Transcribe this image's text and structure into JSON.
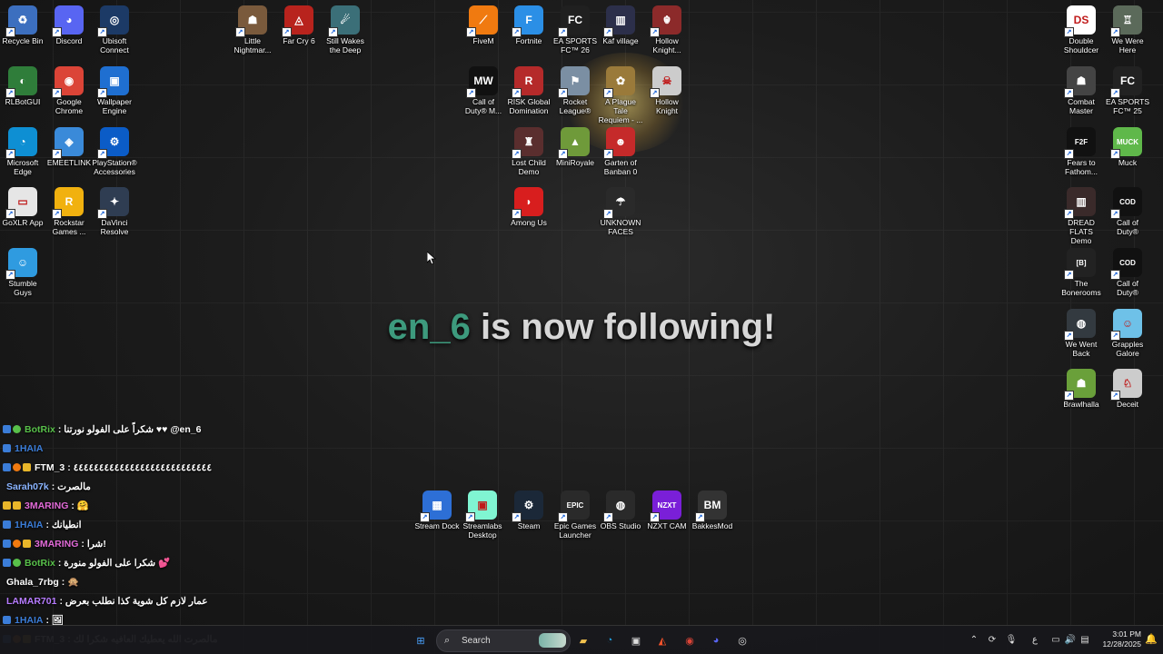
{
  "desktop": {
    "left_icons": [
      {
        "label": "Recycle Bin",
        "icon": "recycle-bin-icon",
        "color": "#3c6fbf",
        "glyph": "♻"
      },
      {
        "label": "Discord",
        "icon": "discord-icon",
        "color": "#5865f2",
        "glyph": "◕"
      },
      {
        "label": "Ubisoft Connect",
        "icon": "ubisoft-icon",
        "color": "#1c3a66",
        "glyph": "◎"
      },
      {
        "label": "RLBotGUI",
        "icon": "rlbot-icon",
        "color": "#2f7d3a",
        "glyph": "◐"
      },
      {
        "label": "Google Chrome",
        "icon": "chrome-icon",
        "color": "#db4437",
        "glyph": "◉"
      },
      {
        "label": "Wallpaper Engine",
        "icon": "wallpaper-engine-icon",
        "color": "#1f6fd1",
        "glyph": "▣"
      },
      {
        "label": "Microsoft Edge",
        "icon": "edge-icon",
        "color": "#0e8fd3",
        "glyph": "◔"
      },
      {
        "label": "EMEETLINK",
        "icon": "emeetlink-icon",
        "color": "#3a8ad9",
        "glyph": "◈"
      },
      {
        "label": "PlayStation® Accessories",
        "icon": "playstation-icon",
        "color": "#0b5cc7",
        "glyph": "⚙"
      },
      {
        "label": "GoXLR App",
        "icon": "goxlr-icon",
        "color": "#e6e6e6",
        "glyph": "▭"
      },
      {
        "label": "Rockstar Games ...",
        "icon": "rockstar-icon",
        "color": "#f1b10f",
        "glyph": "R"
      },
      {
        "label": "DaVinci Resolve",
        "icon": "davinci-icon",
        "color": "#2f3d52",
        "glyph": "✦"
      },
      {
        "label": "Stumble Guys",
        "icon": "stumble-guys-icon",
        "color": "#2f9be0",
        "glyph": "☺"
      }
    ],
    "top_games": [
      {
        "label": "Little Nightmar...",
        "icon": "little-nightmares-icon",
        "color": "#7a5a3c",
        "glyph": "☗"
      },
      {
        "label": "Far Cry 6",
        "icon": "far-cry-6-icon",
        "color": "#b8231d",
        "glyph": "◬"
      },
      {
        "label": "Still Wakes the Deep",
        "icon": "still-wakes-icon",
        "color": "#3b6f78",
        "glyph": "☄"
      }
    ],
    "mid_icons": [
      {
        "label": "FiveM",
        "icon": "fivem-icon",
        "color": "#f07a10",
        "glyph": "⟋"
      },
      {
        "label": "Fortnite",
        "icon": "fortnite-icon",
        "color": "#2b8fe6",
        "glyph": "F"
      },
      {
        "label": "EA SPORTS FC™ 26",
        "icon": "ea-fc26-icon",
        "color": "#202020",
        "glyph": "FC"
      },
      {
        "label": "Kaf village",
        "icon": "kaf-village-icon",
        "color": "#2c2f4a",
        "glyph": "▥"
      },
      {
        "label": "Hollow Knight...",
        "icon": "hollow-knight-silksong-icon",
        "color": "#8c2a2a",
        "glyph": "☬"
      },
      {
        "label": "Call of Duty® M...",
        "icon": "cod-mw3-icon",
        "color": "#111111",
        "glyph": "MW"
      },
      {
        "label": "RISK Global Domination",
        "icon": "risk-icon",
        "color": "#b52a2a",
        "glyph": "R"
      },
      {
        "label": "Rocket League®",
        "icon": "rocket-league-icon",
        "color": "#7b8fa3",
        "glyph": "⚑"
      },
      {
        "label": "A Plague Tale Requiem - ...",
        "icon": "plague-tale-icon",
        "color": "#9a7a3a",
        "glyph": "✿"
      },
      {
        "label": "Hollow Knight",
        "icon": "hollow-knight-icon",
        "color": "#cccccc",
        "glyph": "☠"
      },
      {
        "label": "Lost Child Demo",
        "icon": "lost-child-icon",
        "color": "#5a2e2e",
        "glyph": "♜"
      },
      {
        "label": "MiniRoyale",
        "icon": "miniroyale-icon",
        "color": "#6f9a3a",
        "glyph": "▲"
      },
      {
        "label": "Garten of Banban 0",
        "icon": "banban-icon",
        "color": "#c52a2a",
        "glyph": "☻"
      },
      {
        "label": "Among Us",
        "icon": "among-us-icon",
        "color": "#d81e1e",
        "glyph": "◗"
      },
      {
        "label": "UNKNOWN FACES",
        "icon": "unknown-faces-icon",
        "color": "#2a2a2a",
        "glyph": "☂"
      }
    ],
    "dock_icons": [
      {
        "label": "Stream Dock",
        "icon": "stream-dock-icon",
        "color": "#2d6fd6",
        "glyph": "▦"
      },
      {
        "label": "Streamlabs Desktop",
        "icon": "streamlabs-icon",
        "color": "#80f5d2",
        "glyph": "▣"
      },
      {
        "label": "Steam",
        "icon": "steam-icon",
        "color": "#1b2838",
        "glyph": "⚙"
      },
      {
        "label": "Epic Games Launcher",
        "icon": "epic-games-icon",
        "color": "#2a2a2a",
        "glyph": "EPIC"
      },
      {
        "label": "OBS Studio",
        "icon": "obs-icon",
        "color": "#2a2a2a",
        "glyph": "◍"
      },
      {
        "label": "NZXT CAM",
        "icon": "nzxt-cam-icon",
        "color": "#7a1fd8",
        "glyph": "NZXT"
      },
      {
        "label": "BakkesMod",
        "icon": "bakkesmod-icon",
        "color": "#333333",
        "glyph": "BM"
      }
    ],
    "right_icons": [
      {
        "label": "Double Shouldcer",
        "icon": "double-shouldcer-icon",
        "color": "#ffffff",
        "glyph": "DS"
      },
      {
        "label": "We Were Here",
        "icon": "we-were-here-icon",
        "color": "#5b6a5a",
        "glyph": "♖"
      },
      {
        "label": "Combat Master",
        "icon": "combat-master-icon",
        "color": "#444444",
        "glyph": "☗"
      },
      {
        "label": "EA SPORTS FC™ 25",
        "icon": "ea-fc25-icon",
        "color": "#222222",
        "glyph": "FC"
      },
      {
        "label": "Fears to Fathom...",
        "icon": "fears-to-fathom-icon",
        "color": "#111111",
        "glyph": "F2F"
      },
      {
        "label": "Muck",
        "icon": "muck-icon",
        "color": "#5fb84a",
        "glyph": "MUCK"
      },
      {
        "label": "DREAD FLATS Demo",
        "icon": "dread-flats-icon",
        "color": "#3a2a2a",
        "glyph": "▥"
      },
      {
        "label": "Call of Duty®",
        "icon": "cod-icon-1",
        "color": "#111111",
        "glyph": "COD"
      },
      {
        "label": "The Bonerooms",
        "icon": "bonerooms-icon",
        "color": "#222222",
        "glyph": "[B]"
      },
      {
        "label": "Call of Duty®",
        "icon": "cod-icon-2",
        "color": "#111111",
        "glyph": "COD"
      },
      {
        "label": "We Went Back",
        "icon": "we-went-back-icon",
        "color": "#333a40",
        "glyph": "◍"
      },
      {
        "label": "Grapples Galore",
        "icon": "grapples-galore-icon",
        "color": "#6ec1e8",
        "glyph": "☺"
      },
      {
        "label": "Brawlhalla",
        "icon": "brawlhalla-icon",
        "color": "#6aa03a",
        "glyph": "☗"
      },
      {
        "label": "Deceit",
        "icon": "deceit-icon",
        "color": "#cccccc",
        "glyph": "♘"
      }
    ]
  },
  "alert": {
    "username": "en_6",
    "message": "is now following!"
  },
  "chat": [
    {
      "user": "BotRix",
      "color": "#58c04a",
      "badges": [
        "b-blue",
        "b-green"
      ],
      "text": ": شكراً على الفولو نورتنا ♥♥ @en_6"
    },
    {
      "user": "1HAIA",
      "color": "#3b7dd8",
      "badges": [
        "b-blue"
      ],
      "text": ""
    },
    {
      "user": "FTM_3",
      "color": "#ffffff",
      "badges": [
        "b-blue",
        "b-orange",
        "b-gold"
      ],
      "text": ": ٤٤٤٤٤٤٤٤٤٤٤٤٤٤٤٤٤٤٤٤٤٤٤٤٤٤٤"
    },
    {
      "user": "Sarah07k",
      "color": "#8ab4ff",
      "badges": [],
      "text": ": مالصرت"
    },
    {
      "user": "3MARING",
      "color": "#e26ad8",
      "badges": [
        "b-gold",
        "b-gold"
      ],
      "text": ": 🤗"
    },
    {
      "user": "1HAIA",
      "color": "#3b7dd8",
      "badges": [
        "b-blue"
      ],
      "text": ": انطيانك"
    },
    {
      "user": "3MARING",
      "color": "#e26ad8",
      "badges": [
        "b-blue",
        "b-orange",
        "b-gold"
      ],
      "text": ": شرا!"
    },
    {
      "user": "BotRix",
      "color": "#58c04a",
      "badges": [
        "b-blue",
        "b-green"
      ],
      "text": ": شكرا على الفولو منورة 💕"
    },
    {
      "user": "Ghala_7rbg",
      "color": "#ffffff",
      "badges": [],
      "text": ": 🙊"
    },
    {
      "user": "LAMAR701",
      "color": "#b67bff",
      "badges": [],
      "text": ": عمار لازم كل شوية كذا نطلب بعرض"
    },
    {
      "user": "1HAIA",
      "color": "#3b7dd8",
      "badges": [
        "b-blue"
      ],
      "text": ": 🖼"
    },
    {
      "user": "FTM_3",
      "color": "#ffffff",
      "badges": [
        "b-blue",
        "b-orange",
        "b-gold"
      ],
      "text": ": مالصرت الله يعطيك العافيه شكرا لك"
    }
  ],
  "taskbar": {
    "search_placeholder": "Search",
    "apps": [
      {
        "name": "start-button",
        "glyph": "⊞",
        "color": "#4aa3ff"
      },
      {
        "name": "file-explorer-icon",
        "glyph": "▰",
        "color": "#f2c14e"
      },
      {
        "name": "edge-taskbar-icon",
        "glyph": "◔",
        "color": "#1fa0e0"
      },
      {
        "name": "store-icon",
        "glyph": "▣",
        "color": "#dddddd"
      },
      {
        "name": "brave-icon",
        "glyph": "◭",
        "color": "#fb542b"
      },
      {
        "name": "chrome-taskbar-icon",
        "glyph": "◉",
        "color": "#db4437"
      },
      {
        "name": "discord-taskbar-icon",
        "glyph": "◕",
        "color": "#5865f2"
      },
      {
        "name": "steam-taskbar-icon",
        "glyph": "◎",
        "color": "#dddddd"
      }
    ],
    "tray": {
      "lang": "ع",
      "time": "3:01 PM",
      "date": "12/28/2025"
    }
  }
}
